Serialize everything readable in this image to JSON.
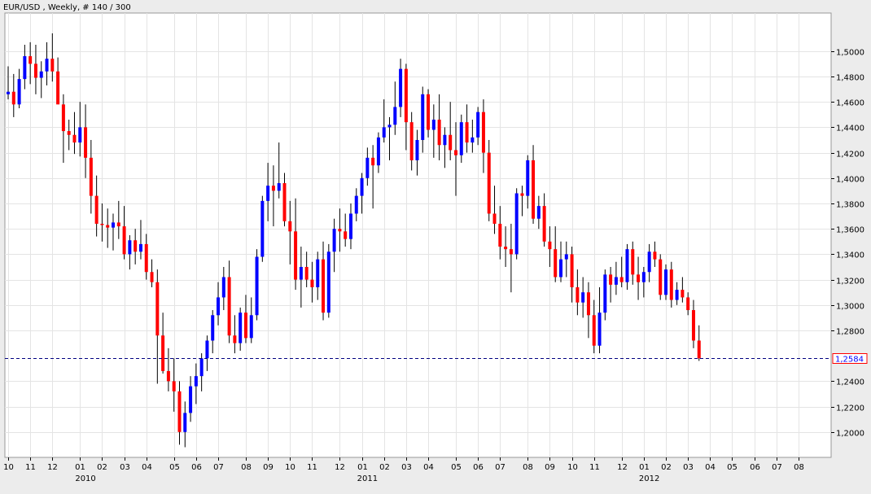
{
  "chart_data": {
    "type": "candlestick",
    "title": "EUR/USD , Weekly, # 140 / 300",
    "last_price_label": "1,2584",
    "last_price": 1.2584,
    "ylim": [
      1.18,
      1.53
    ],
    "y_ticks": [
      {
        "value": 1.2,
        "label": "1,2000"
      },
      {
        "value": 1.22,
        "label": "1,2200"
      },
      {
        "value": 1.24,
        "label": "1,2400"
      },
      {
        "value": 1.28,
        "label": "1,2800"
      },
      {
        "value": 1.3,
        "label": "1,3000"
      },
      {
        "value": 1.32,
        "label": "1,3200"
      },
      {
        "value": 1.34,
        "label": "1,3400"
      },
      {
        "value": 1.36,
        "label": "1,3600"
      },
      {
        "value": 1.38,
        "label": "1,3800"
      },
      {
        "value": 1.4,
        "label": "1,4000"
      },
      {
        "value": 1.42,
        "label": "1,4200"
      },
      {
        "value": 1.44,
        "label": "1,4400"
      },
      {
        "value": 1.46,
        "label": "1,4600"
      },
      {
        "value": 1.48,
        "label": "1,4800"
      },
      {
        "value": 1.5,
        "label": "1,5000"
      }
    ],
    "x_ticks": [
      {
        "bar": 0,
        "label": "10"
      },
      {
        "bar": 4,
        "label": "11"
      },
      {
        "bar": 8,
        "label": "12"
      },
      {
        "bar": 13,
        "label": "01"
      },
      {
        "bar": 17,
        "label": "02"
      },
      {
        "bar": 21,
        "label": "03"
      },
      {
        "bar": 25,
        "label": "04"
      },
      {
        "bar": 30,
        "label": "05"
      },
      {
        "bar": 34,
        "label": "06"
      },
      {
        "bar": 38,
        "label": "07"
      },
      {
        "bar": 43,
        "label": "08"
      },
      {
        "bar": 47,
        "label": "09"
      },
      {
        "bar": 51,
        "label": "10"
      },
      {
        "bar": 55,
        "label": "11"
      },
      {
        "bar": 60,
        "label": "12"
      },
      {
        "bar": 64,
        "label": "01"
      },
      {
        "bar": 68,
        "label": "02"
      },
      {
        "bar": 72,
        "label": "03"
      },
      {
        "bar": 76,
        "label": "04"
      },
      {
        "bar": 81,
        "label": "05"
      },
      {
        "bar": 85,
        "label": "06"
      },
      {
        "bar": 89,
        "label": "07"
      },
      {
        "bar": 94,
        "label": "08"
      },
      {
        "bar": 98,
        "label": "09"
      },
      {
        "bar": 102,
        "label": "10"
      },
      {
        "bar": 106,
        "label": "11"
      },
      {
        "bar": 111,
        "label": "12"
      },
      {
        "bar": 115,
        "label": "01"
      },
      {
        "bar": 119,
        "label": "02"
      },
      {
        "bar": 123,
        "label": "03"
      },
      {
        "bar": 127,
        "label": "04"
      },
      {
        "bar": 131,
        "label": "05"
      },
      {
        "bar": 135,
        "label": "06"
      },
      {
        "bar": 139,
        "label": "07"
      },
      {
        "bar": 143,
        "label": "08"
      }
    ],
    "year_labels": [
      {
        "bar": 14,
        "label": "2010"
      },
      {
        "bar": 65,
        "label": "2011"
      },
      {
        "bar": 116,
        "label": "2012"
      }
    ],
    "colors": {
      "up": "#0000ff",
      "down": "#ff0000",
      "wick": "#000000",
      "last_price_line": "#000080",
      "last_price_box": "#ff0000"
    },
    "ohlc": [
      [
        1.466,
        1.488,
        1.462,
        1.468
      ],
      [
        1.468,
        1.482,
        1.448,
        1.458
      ],
      [
        1.458,
        1.486,
        1.455,
        1.478
      ],
      [
        1.478,
        1.505,
        1.47,
        1.496
      ],
      [
        1.496,
        1.507,
        1.474,
        1.49
      ],
      [
        1.49,
        1.505,
        1.466,
        1.479
      ],
      [
        1.479,
        1.492,
        1.463,
        1.484
      ],
      [
        1.484,
        1.507,
        1.473,
        1.494
      ],
      [
        1.494,
        1.514,
        1.476,
        1.484
      ],
      [
        1.484,
        1.495,
        1.46,
        1.458
      ],
      [
        1.458,
        1.466,
        1.412,
        1.437
      ],
      [
        1.437,
        1.446,
        1.422,
        1.434
      ],
      [
        1.434,
        1.452,
        1.419,
        1.428
      ],
      [
        1.428,
        1.46,
        1.417,
        1.44
      ],
      [
        1.44,
        1.458,
        1.4,
        1.416
      ],
      [
        1.416,
        1.43,
        1.372,
        1.386
      ],
      [
        1.386,
        1.402,
        1.354,
        1.364
      ],
      [
        1.364,
        1.38,
        1.35,
        1.363
      ],
      [
        1.363,
        1.376,
        1.345,
        1.361
      ],
      [
        1.361,
        1.372,
        1.343,
        1.365
      ],
      [
        1.365,
        1.382,
        1.352,
        1.362
      ],
      [
        1.362,
        1.378,
        1.336,
        1.34
      ],
      [
        1.34,
        1.355,
        1.328,
        1.351
      ],
      [
        1.351,
        1.36,
        1.332,
        1.342
      ],
      [
        1.342,
        1.367,
        1.336,
        1.348
      ],
      [
        1.348,
        1.356,
        1.32,
        1.326
      ],
      [
        1.326,
        1.336,
        1.314,
        1.318
      ],
      [
        1.318,
        1.328,
        1.238,
        1.276
      ],
      [
        1.276,
        1.294,
        1.246,
        1.248
      ],
      [
        1.248,
        1.266,
        1.232,
        1.24
      ],
      [
        1.24,
        1.258,
        1.216,
        1.232
      ],
      [
        1.232,
        1.24,
        1.19,
        1.2
      ],
      [
        1.2,
        1.224,
        1.188,
        1.215
      ],
      [
        1.215,
        1.244,
        1.208,
        1.236
      ],
      [
        1.236,
        1.254,
        1.222,
        1.244
      ],
      [
        1.244,
        1.262,
        1.232,
        1.258
      ],
      [
        1.258,
        1.276,
        1.248,
        1.272
      ],
      [
        1.272,
        1.296,
        1.262,
        1.292
      ],
      [
        1.292,
        1.318,
        1.284,
        1.306
      ],
      [
        1.306,
        1.33,
        1.296,
        1.322
      ],
      [
        1.322,
        1.335,
        1.27,
        1.276
      ],
      [
        1.276,
        1.292,
        1.262,
        1.27
      ],
      [
        1.27,
        1.298,
        1.264,
        1.294
      ],
      [
        1.294,
        1.308,
        1.27,
        1.274
      ],
      [
        1.274,
        1.306,
        1.27,
        1.292
      ],
      [
        1.292,
        1.344,
        1.288,
        1.338
      ],
      [
        1.338,
        1.386,
        1.334,
        1.382
      ],
      [
        1.382,
        1.412,
        1.366,
        1.394
      ],
      [
        1.394,
        1.41,
        1.362,
        1.39
      ],
      [
        1.39,
        1.428,
        1.384,
        1.396
      ],
      [
        1.396,
        1.404,
        1.362,
        1.366
      ],
      [
        1.366,
        1.382,
        1.332,
        1.358
      ],
      [
        1.358,
        1.384,
        1.312,
        1.32
      ],
      [
        1.32,
        1.346,
        1.298,
        1.33
      ],
      [
        1.33,
        1.342,
        1.314,
        1.32
      ],
      [
        1.32,
        1.334,
        1.302,
        1.314
      ],
      [
        1.314,
        1.342,
        1.304,
        1.336
      ],
      [
        1.336,
        1.35,
        1.288,
        1.294
      ],
      [
        1.294,
        1.348,
        1.29,
        1.342
      ],
      [
        1.342,
        1.368,
        1.326,
        1.36
      ],
      [
        1.36,
        1.376,
        1.342,
        1.358
      ],
      [
        1.358,
        1.372,
        1.346,
        1.352
      ],
      [
        1.352,
        1.38,
        1.344,
        1.372
      ],
      [
        1.372,
        1.392,
        1.366,
        1.386
      ],
      [
        1.386,
        1.404,
        1.372,
        1.4
      ],
      [
        1.4,
        1.424,
        1.394,
        1.416
      ],
      [
        1.416,
        1.426,
        1.376,
        1.41
      ],
      [
        1.41,
        1.436,
        1.404,
        1.432
      ],
      [
        1.432,
        1.462,
        1.428,
        1.44
      ],
      [
        1.44,
        1.448,
        1.414,
        1.442
      ],
      [
        1.442,
        1.476,
        1.434,
        1.456
      ],
      [
        1.456,
        1.494,
        1.448,
        1.486
      ],
      [
        1.486,
        1.49,
        1.422,
        1.444
      ],
      [
        1.444,
        1.452,
        1.406,
        1.414
      ],
      [
        1.414,
        1.438,
        1.402,
        1.43
      ],
      [
        1.43,
        1.472,
        1.42,
        1.466
      ],
      [
        1.466,
        1.47,
        1.432,
        1.438
      ],
      [
        1.438,
        1.458,
        1.416,
        1.446
      ],
      [
        1.446,
        1.466,
        1.414,
        1.426
      ],
      [
        1.426,
        1.44,
        1.408,
        1.434
      ],
      [
        1.434,
        1.46,
        1.414,
        1.422
      ],
      [
        1.422,
        1.444,
        1.386,
        1.418
      ],
      [
        1.418,
        1.45,
        1.412,
        1.444
      ],
      [
        1.444,
        1.458,
        1.42,
        1.428
      ],
      [
        1.428,
        1.446,
        1.42,
        1.432
      ],
      [
        1.432,
        1.456,
        1.426,
        1.452
      ],
      [
        1.452,
        1.462,
        1.404,
        1.42
      ],
      [
        1.42,
        1.43,
        1.366,
        1.372
      ],
      [
        1.372,
        1.394,
        1.356,
        1.364
      ],
      [
        1.364,
        1.378,
        1.336,
        1.346
      ],
      [
        1.346,
        1.362,
        1.33,
        1.344
      ],
      [
        1.344,
        1.364,
        1.31,
        1.34
      ],
      [
        1.34,
        1.392,
        1.336,
        1.388
      ],
      [
        1.388,
        1.394,
        1.37,
        1.386
      ],
      [
        1.386,
        1.418,
        1.376,
        1.414
      ],
      [
        1.414,
        1.426,
        1.364,
        1.368
      ],
      [
        1.368,
        1.386,
        1.36,
        1.378
      ],
      [
        1.378,
        1.388,
        1.346,
        1.35
      ],
      [
        1.35,
        1.362,
        1.33,
        1.344
      ],
      [
        1.344,
        1.362,
        1.318,
        1.322
      ],
      [
        1.322,
        1.35,
        1.318,
        1.336
      ],
      [
        1.336,
        1.35,
        1.322,
        1.34
      ],
      [
        1.34,
        1.346,
        1.302,
        1.314
      ],
      [
        1.314,
        1.328,
        1.292,
        1.302
      ],
      [
        1.302,
        1.322,
        1.29,
        1.31
      ],
      [
        1.31,
        1.318,
        1.274,
        1.292
      ],
      [
        1.292,
        1.304,
        1.262,
        1.268
      ],
      [
        1.268,
        1.314,
        1.262,
        1.294
      ],
      [
        1.294,
        1.328,
        1.288,
        1.324
      ],
      [
        1.324,
        1.33,
        1.302,
        1.316
      ],
      [
        1.316,
        1.334,
        1.308,
        1.322
      ],
      [
        1.322,
        1.338,
        1.314,
        1.318
      ],
      [
        1.318,
        1.348,
        1.312,
        1.344
      ],
      [
        1.344,
        1.35,
        1.316,
        1.324
      ],
      [
        1.324,
        1.338,
        1.304,
        1.318
      ],
      [
        1.318,
        1.33,
        1.306,
        1.326
      ],
      [
        1.326,
        1.348,
        1.318,
        1.342
      ],
      [
        1.342,
        1.35,
        1.33,
        1.336
      ],
      [
        1.336,
        1.34,
        1.304,
        1.308
      ],
      [
        1.308,
        1.332,
        1.304,
        1.328
      ],
      [
        1.328,
        1.334,
        1.298,
        1.304
      ],
      [
        1.304,
        1.318,
        1.3,
        1.312
      ],
      [
        1.312,
        1.322,
        1.302,
        1.306
      ],
      [
        1.306,
        1.31,
        1.292,
        1.296
      ],
      [
        1.296,
        1.304,
        1.266,
        1.272
      ],
      [
        1.272,
        1.284,
        1.256,
        1.258
      ]
    ]
  }
}
